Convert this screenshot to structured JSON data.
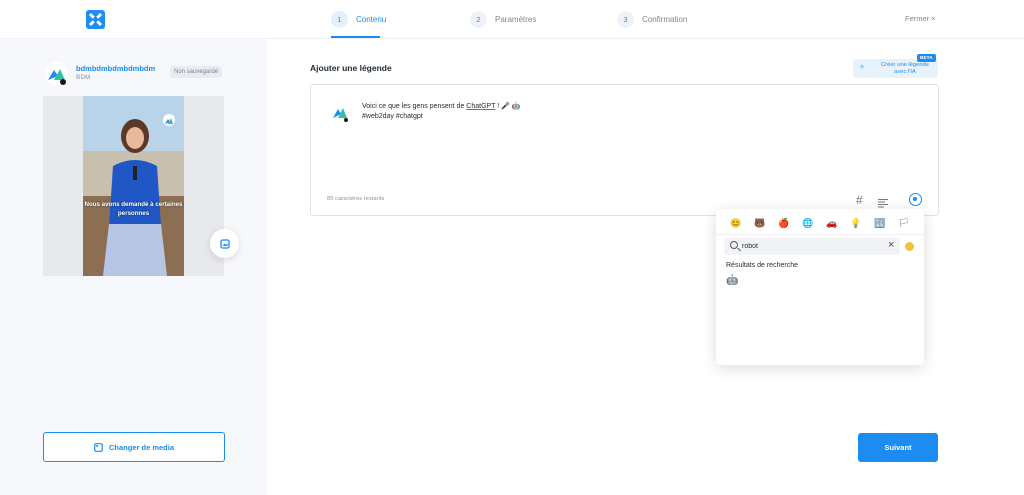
{
  "header": {
    "steps": [
      {
        "num": "1",
        "label": "Contenu"
      },
      {
        "num": "2",
        "label": "Paramètres"
      },
      {
        "num": "3",
        "label": "Confirmation"
      }
    ],
    "close_label": "Fermer ×"
  },
  "sidebar": {
    "account_name": "bdmbdmbdmbdmbdm",
    "account_handle": "BDM",
    "status_badge": "Non sauvegardé",
    "video_caption": "Nous avons demandé à certaines personnes",
    "change_media_label": "Changer de media"
  },
  "main": {
    "section_title": "Ajouter une légende",
    "ai_button_label": "Créer une légende avec l'IA",
    "beta_badge": "BETA",
    "caption_prefix": "Voici ce que les gens pensent de ",
    "caption_link": "ChatGPT",
    "caption_suffix": " ! 🎤 🤖",
    "caption_hashtags": "#web2day #chatgpt",
    "char_count": "85 caractères restants",
    "next_label": "Suivant"
  },
  "emoji_picker": {
    "categories": [
      "😊",
      "🐻",
      "🍎",
      "🌐",
      "🚗",
      "💡",
      "🔣",
      "🏳"
    ],
    "search_value": "robot",
    "results_label": "Résultats de recherche",
    "result_emoji": "🤖"
  },
  "colors": {
    "accent": "#1c8cf0",
    "sidebar_bg": "#f6f8fb"
  }
}
